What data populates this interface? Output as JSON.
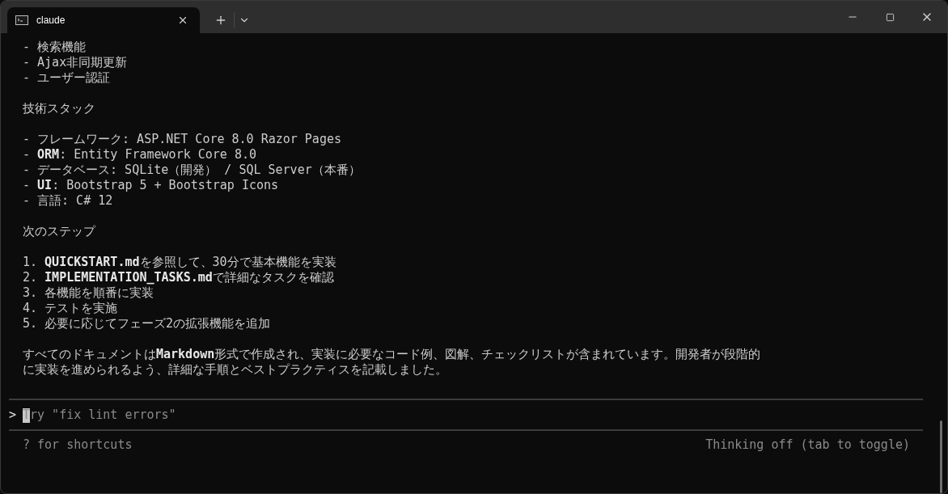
{
  "window": {
    "tab": {
      "title": "claude",
      "selected": true
    }
  },
  "output": {
    "blocks": [
      [
        "- 検索機能",
        "- Ajax非同期更新",
        "- ユーザー認証"
      ],
      [
        "技術スタック"
      ],
      [
        "- フレームワーク: ASP.NET Core 8.0 Razor Pages",
        "- **ORM**: Entity Framework Core 8.0",
        "- データベース: SQLite（開発） / SQL Server（本番）",
        "- **UI**: Bootstrap 5 + Bootstrap Icons",
        "- 言語: C# 12"
      ],
      [
        "次のステップ"
      ],
      [
        "1. **QUICKSTART.md**を参照して、30分で基本機能を実装",
        "2. **IMPLEMENTATION_TASKS.md**で詳細なタスクを確認",
        "3. 各機能を順番に実装",
        "4. テストを実施",
        "5. 必要に応じてフェーズ2の拡張機能を追加"
      ],
      [
        "すべてのドキュメントは**Markdown**形式で作成され、実装に必要なコード例、図解、チェックリストが含まれています。開発者が段階的",
        "に実装を進められるよう、詳細な手順とベストプラクティスを記載しました。"
      ]
    ]
  },
  "prompt": {
    "symbol": ">",
    "placeholder": "Try \"fix lint errors\""
  },
  "footer": {
    "hint": "? for shortcuts",
    "status": "Thinking off (tab to toggle)"
  }
}
